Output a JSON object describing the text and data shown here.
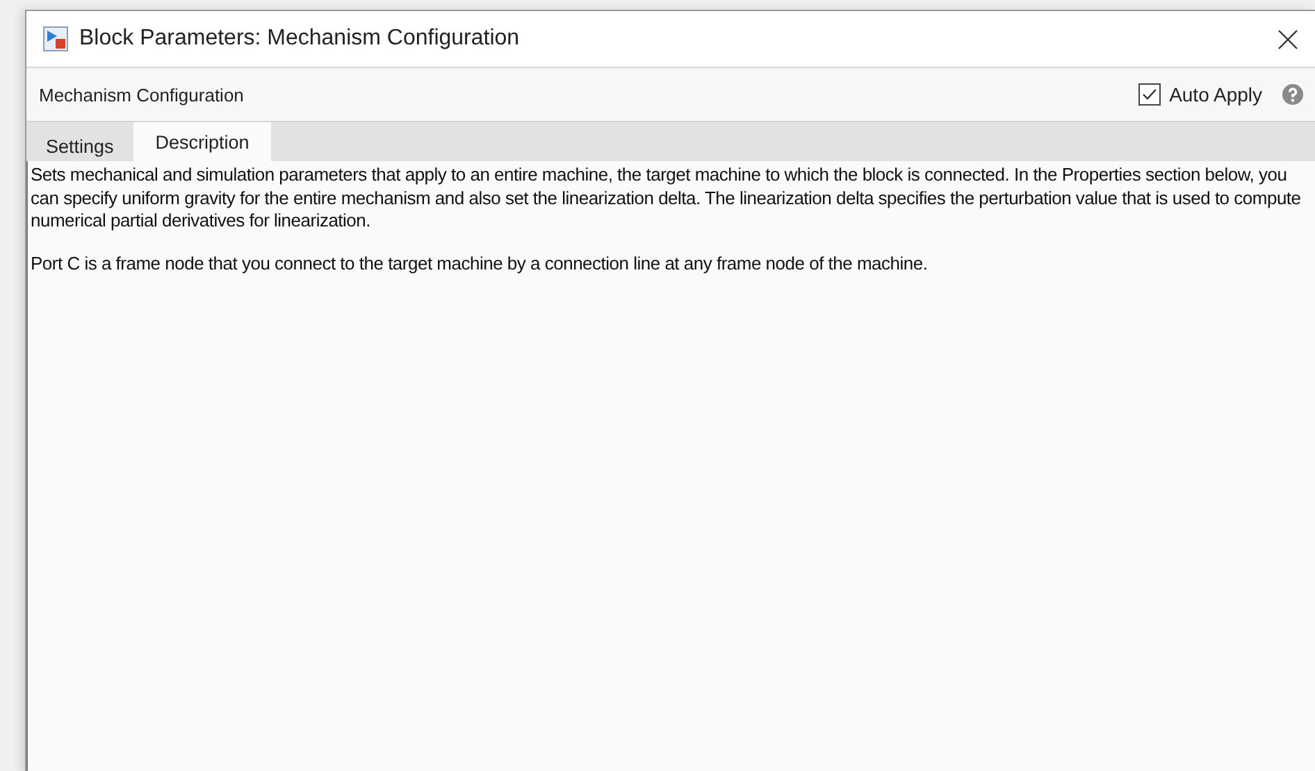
{
  "window": {
    "title": "Block Parameters: Mechanism Configuration"
  },
  "toolbar": {
    "block_name": "Mechanism Configuration",
    "auto_apply": {
      "label": "Auto Apply",
      "checked": true
    }
  },
  "tabs": [
    {
      "label": "Settings",
      "selected": false
    },
    {
      "label": "Description",
      "selected": true
    }
  ],
  "description": [
    "Sets mechanical and simulation parameters that apply to an entire machine, the target machine to which the block is connected. In the Properties section below, you can specify uniform gravity for the entire mechanism and also set the linearization delta. The linearization delta specifies the perturbation value that is used to compute numerical partial derivatives for linearization.",
    "Port C is a frame node that you connect to the target machine by a connection line at any frame node of the machine."
  ]
}
